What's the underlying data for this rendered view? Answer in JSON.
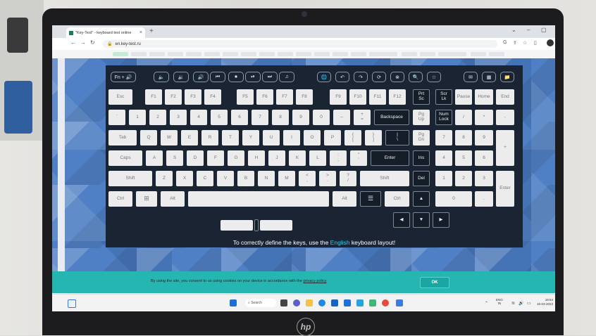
{
  "browser": {
    "tab_title": "\"Key-Test\" - keyboard test online",
    "tab_close": "×",
    "new_tab": "+",
    "url": "en.key-test.ru",
    "window_controls": [
      "⌄",
      "–",
      "▢"
    ],
    "nav": [
      "←",
      "→",
      "↻"
    ]
  },
  "keyboard": {
    "media_keys": [
      "Fn + 🔊",
      "🔈",
      "🔉",
      "🔊",
      "⏮",
      "⏹",
      "⏯",
      "⏭",
      "♫",
      "🌐",
      "↶",
      "↷",
      "⟳",
      "⊗",
      "🔍",
      "☆",
      "✉",
      "▦",
      "📁"
    ],
    "function_row": [
      "Esc",
      "F1",
      "F2",
      "F3",
      "F4",
      "F5",
      "F6",
      "F7",
      "F8",
      "F9",
      "F10",
      "F11",
      "F12",
      "Prt\nSc",
      "Scr\nLk",
      "Pause",
      "Home",
      "End"
    ],
    "number_row": [
      "`",
      "1",
      "2",
      "3",
      "4",
      "5",
      "6",
      "7",
      "8",
      "9",
      "0",
      "–",
      "+\n=",
      "Backspace",
      "Pg\nUp",
      "Num\nLock",
      "/",
      "*",
      "-"
    ],
    "qwerty_row": [
      "Tab",
      "Q",
      "W",
      "E",
      "R",
      "T",
      "Y",
      "U",
      "I",
      "O",
      "P",
      "{\n[",
      "}\n]",
      "|\n\\",
      "Pg\nDn",
      "7",
      "8",
      "9",
      "+"
    ],
    "home_row": [
      "Caps",
      "A",
      "S",
      "D",
      "F",
      "G",
      "H",
      "J",
      "K",
      "L",
      ":\n;",
      "\"\n'",
      "Enter",
      "Ins",
      "4",
      "5",
      "6"
    ],
    "shift_row": [
      "Shift",
      "Z",
      "X",
      "C",
      "V",
      "B",
      "N",
      "M",
      "<\n,",
      ">\n.",
      "?\n/",
      "Shift",
      "Del",
      "1",
      "2",
      "3",
      "Enter"
    ],
    "bottom_row": [
      "Ctrl",
      "⊞",
      "Alt",
      "Alt",
      "☰",
      "Ctrl",
      "▲",
      "0",
      "."
    ],
    "arrows": [
      "◀",
      "▼",
      "▶"
    ],
    "hint_prefix": "To correctly define the keys, use the ",
    "hint_lang": "English",
    "hint_suffix": " keyboard layout!"
  },
  "cookie": {
    "text": "By using the site, you consent to us using cookies on your device in accordance with the ",
    "link": "privacy policy",
    "ok": "OK"
  },
  "taskbar": {
    "search": "Search",
    "lang_top": "ENG",
    "lang_bottom": "IN",
    "time": "18:54",
    "date": "15-03-2023"
  },
  "device": {
    "brand": "hp"
  },
  "colors": {
    "accent": "#35c8e6",
    "cookie_bg": "#25b6b1",
    "panel": "#1a2433"
  }
}
